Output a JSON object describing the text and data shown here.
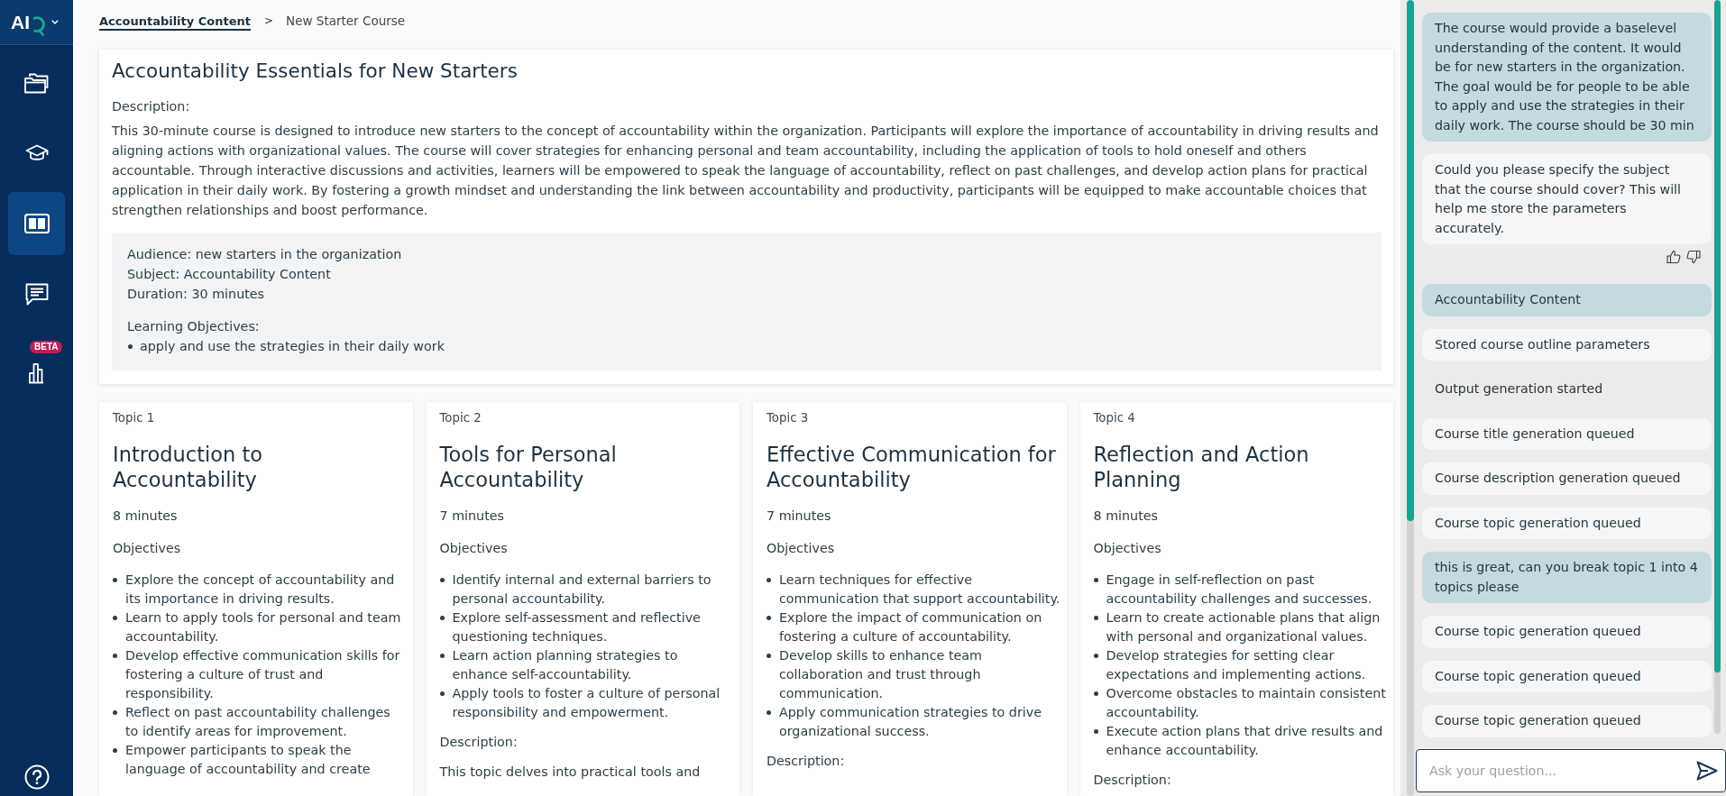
{
  "sidebar": {
    "logo": "AI",
    "nav": [
      {
        "selected": false
      },
      {
        "selected": false
      },
      {
        "selected": true
      },
      {
        "selected": false
      },
      {
        "selected": false,
        "badge": "BETA"
      }
    ]
  },
  "breadcrumb": {
    "items": [
      {
        "label": "Accountability Content",
        "link": true
      },
      {
        "label": "New Starter Course",
        "link": false
      }
    ],
    "separator": ">"
  },
  "course": {
    "title": "Accountability Essentials for New Starters",
    "description_label": "Description:",
    "description": "This 30-minute course is designed to introduce new starters to the concept of accountability within the organization. Participants will explore the importance of accountability in driving results and aligning actions with organizational values. The course will cover strategies for enhancing personal and team accountability, including the application of tools to hold oneself and others accountable. Through interactive discussions and activities, learners will be empowered to speak the language of accountability, reflect on past challenges, and develop action plans for practical application in their daily work. By fostering a growth mindset and understanding the link between accountability and productivity, participants will be equipped to make accountable choices that strengthen relationships and boost performance.",
    "details": [
      "Audience: new starters in the organization",
      "Subject: Accountability Content",
      "Duration: 30 minutes"
    ],
    "objectives_label": "Learning Objectives:",
    "objectives": [
      "apply and use the strategies in their daily work"
    ]
  },
  "topics": [
    {
      "label": "Topic 1",
      "title": "Introduction to Accountability",
      "duration": "8 minutes",
      "objectives_label": "Objectives",
      "objectives": [
        "Explore the concept of accountability and its importance in driving results.",
        "Learn to apply tools for personal and team accountability.",
        "Develop effective communication skills for fostering a culture of trust and responsibility.",
        "Reflect on past accountability challenges to identify areas for improvement.",
        "Empower participants to speak the language of accountability and create"
      ]
    },
    {
      "label": "Topic 2",
      "title": "Tools for Personal Accountability",
      "duration": "7 minutes",
      "objectives_label": "Objectives",
      "objectives": [
        "Identify internal and external barriers to personal accountability.",
        "Explore self-assessment and reflective questioning techniques.",
        "Learn action planning strategies to enhance self-accountability.",
        "Apply tools to foster a culture of personal responsibility and empowerment."
      ],
      "description_label": "Description:",
      "description": "This topic delves into practical tools and"
    },
    {
      "label": "Topic 3",
      "title": "Effective Communication for Accountability",
      "duration": "7 minutes",
      "objectives_label": "Objectives",
      "objectives": [
        "Learn techniques for effective communication that support accountability.",
        "Explore the impact of communication on fostering a culture of accountability.",
        "Develop skills to enhance team collaboration and trust through communication.",
        "Apply communication strategies to drive organizational success."
      ],
      "description_label": "Description:"
    },
    {
      "label": "Topic 4",
      "title": "Reflection and Action Planning",
      "duration": "8 minutes",
      "objectives_label": "Objectives",
      "objectives": [
        "Engage in self-reflection on past accountability challenges and successes.",
        "Learn to create actionable plans that align with personal and organizational values.",
        "Develop strategies for setting clear expectations and implementing actions.",
        "Overcome obstacles to maintain consistent accountability.",
        "Execute action plans that drive results and enhance accountability."
      ],
      "description_label": "Description:"
    }
  ],
  "chat": {
    "messages": [
      {
        "kind": "user",
        "text": "The course would provide a baselevel understanding of the content. It would be for new starters in the organization. The goal would be for people to be able to apply and use the strategies in their daily work. The course should be 30 min"
      },
      {
        "kind": "assistant",
        "text": "Could you please specify the subject that the course should cover? This will help me store the parameters accurately.",
        "feedback": true
      },
      {
        "kind": "user",
        "text": "Accountability Content"
      },
      {
        "kind": "assistant",
        "text": "Stored course outline parameters"
      },
      {
        "kind": "status",
        "text": "Output generation started"
      },
      {
        "kind": "assistant",
        "text": "Course title generation queued"
      },
      {
        "kind": "assistant",
        "text": "Course description generation queued"
      },
      {
        "kind": "assistant",
        "text": "Course topic generation queued"
      },
      {
        "kind": "user",
        "text": "this is great, can you break topic 1 into 4 topics please"
      },
      {
        "kind": "assistant",
        "text": "Course topic generation queued"
      },
      {
        "kind": "assistant",
        "text": "Course topic generation queued"
      },
      {
        "kind": "assistant",
        "text": "Course topic generation queued"
      }
    ],
    "input": {
      "placeholder": "Ask your question..."
    }
  }
}
